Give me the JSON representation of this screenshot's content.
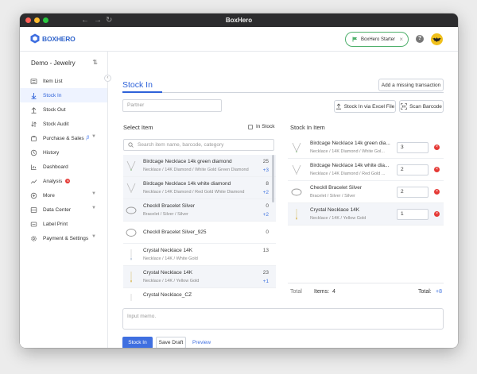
{
  "window": {
    "title": "BoxHero",
    "back_glyph": "←",
    "forward_glyph": "→",
    "reload_glyph": "↻"
  },
  "header": {
    "logo_text": "BOXHERO",
    "plan_label": "BoxHero Starter",
    "close_glyph": "×",
    "help_glyph": "?"
  },
  "sidebar": {
    "workspace": "Demo - Jewelry",
    "sort_glyph": "⇅",
    "collapse_glyph": "‹",
    "items": [
      {
        "label": "Item List"
      },
      {
        "label": "Stock In"
      },
      {
        "label": "Stock Out"
      },
      {
        "label": "Stock Audit"
      },
      {
        "label": "Purchase & Sales",
        "beta": "β"
      },
      {
        "label": "History"
      },
      {
        "label": "Dashboard"
      },
      {
        "label": "Analysis",
        "badge": "N"
      },
      {
        "label": "More"
      },
      {
        "label": "Data Center"
      },
      {
        "label": "Label Print"
      },
      {
        "label": "Payment & Settings"
      }
    ]
  },
  "main": {
    "title": "Stock In",
    "add_missing": "Add a missing transaction",
    "partner_placeholder": "Partner",
    "excel_button": "Stock In via Excel File",
    "barcode_button": "Scan Barcode",
    "select_item_title": "Select Item",
    "in_stock_label": "In Stock",
    "search_placeholder": "Search item name, barcode, category",
    "stock_in_item_title": "Stock In Item",
    "total_label": "Total",
    "items_label": "Items:",
    "items_count": "4",
    "total_right_label": "Total:",
    "total_right_value": "+8",
    "memo_placeholder": "Input memo.",
    "stock_in_button": "Stock In",
    "save_draft_button": "Save Draft",
    "preview_link": "Preview"
  },
  "item_list": [
    {
      "name": "Birdcage Necklace 14k green diamond",
      "desc": "Necklace / 14K Diamond / White Gold Green Diamond",
      "qty": "25",
      "add": "+3",
      "icon": "necklace-v-icon",
      "selected": true
    },
    {
      "name": "Birdcage Necklace 14k white diamond",
      "desc": "Necklace / 14K Diamond / Red Gold White Diamond",
      "qty": "8",
      "add": "+2",
      "icon": "necklace-v-icon",
      "selected": true
    },
    {
      "name": "Checkll Bracelet Silver",
      "desc": "Bracelet / Silver / Silver",
      "qty": "0",
      "add": "+2",
      "icon": "bracelet-icon",
      "selected": true
    },
    {
      "name": "Checkll Bracelet Silver_925",
      "desc": "",
      "qty": "0",
      "add": "",
      "icon": "bracelet-icon",
      "selected": false
    },
    {
      "name": "Crystal Necklace 14K",
      "desc": "Necklace / 14K / White Gold",
      "qty": "13",
      "add": "",
      "icon": "pendant-icon",
      "selected": false
    },
    {
      "name": "Crystal Necklace 14K",
      "desc": "Necklace / 14K / Yellow Gold",
      "qty": "23",
      "add": "+1",
      "icon": "pendant-icon",
      "selected": true
    },
    {
      "name": "Crystal Necklace_CZ",
      "desc": "",
      "qty": "",
      "add": "",
      "icon": "pendant-icon",
      "selected": false
    }
  ],
  "stock_in_items": [
    {
      "name": "Birdcage Necklace 14k green dia...",
      "desc": "Necklace / 14K Diamond / White Gol...",
      "qty": "3",
      "icon": "necklace-v-icon"
    },
    {
      "name": "Birdcage Necklace 14k white dia...",
      "desc": "Necklace / 14K Diamond / Red Gold ...",
      "qty": "2",
      "icon": "necklace-v-icon"
    },
    {
      "name": "Checkll Bracelet Silver",
      "desc": "Bracelet / Silver / Silver",
      "qty": "2",
      "icon": "bracelet-icon"
    },
    {
      "name": "Crystal Necklace 14K",
      "desc": "Necklace / 14K / Yellow Gold",
      "qty": "1",
      "icon": "pendant-icon"
    }
  ],
  "colors": {
    "accent": "#2e62d9",
    "primary_button": "#3f6fe0",
    "remove": "#e53935",
    "plan_border": "#4fb06c",
    "avatar": "#f0c01c",
    "titlebar": "#2c2c2e"
  }
}
